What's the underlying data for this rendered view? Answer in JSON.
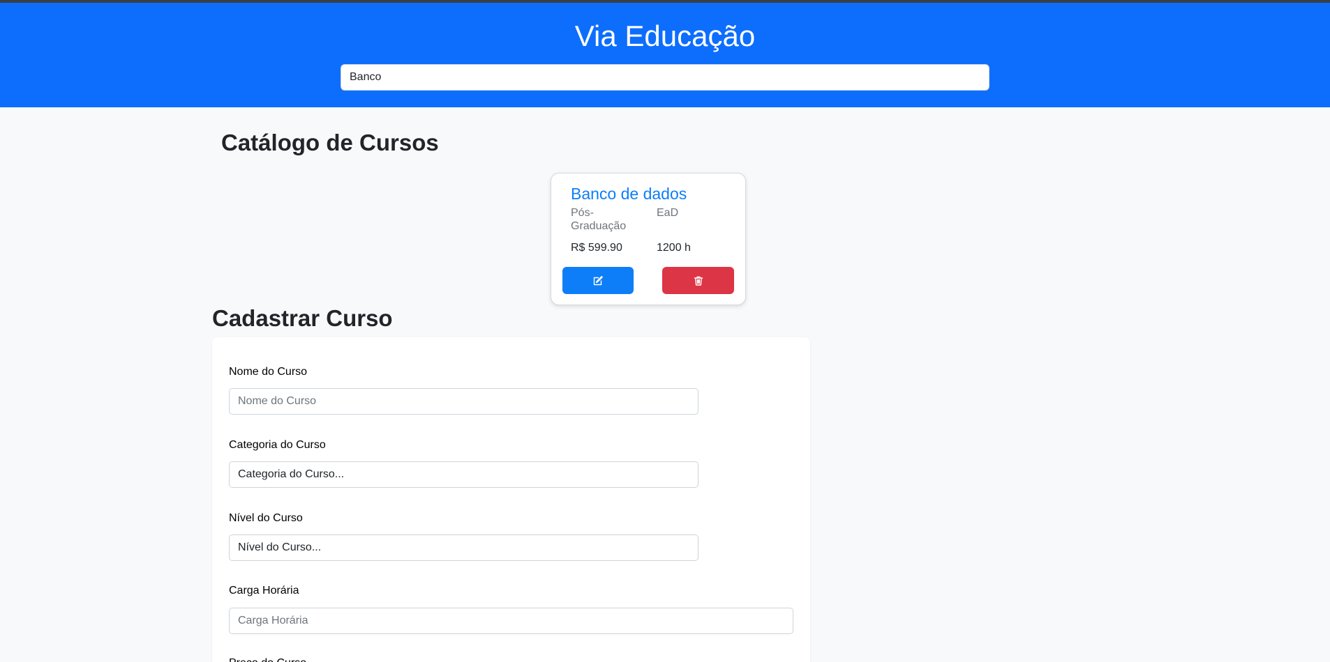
{
  "header": {
    "title": "Via Educação",
    "search_value": "Banco"
  },
  "catalog": {
    "title": "Catálogo de Cursos",
    "courses": [
      {
        "name": "Banco de dados",
        "level": "Pós-Graduação",
        "modality": "EaD",
        "price": "R$ 599.90",
        "hours": "1200 h"
      }
    ]
  },
  "form": {
    "title": "Cadastrar Curso",
    "fields": {
      "name": {
        "label": "Nome do Curso",
        "placeholder": "Nome do Curso"
      },
      "category": {
        "label": "Categoria do Curso",
        "value": "Categoria do Curso..."
      },
      "level": {
        "label": "Nível do Curso",
        "value": "Nível do Curso..."
      },
      "hours": {
        "label": "Carga Horária",
        "placeholder": "Carga Horária"
      },
      "price": {
        "label": "Preço do Curso"
      }
    }
  },
  "icons": {
    "edit": "edit-icon",
    "delete": "trash-icon"
  },
  "colors": {
    "primary": "#0d6efd",
    "card_accent": "#0d7ef7",
    "danger": "#dc3545"
  }
}
